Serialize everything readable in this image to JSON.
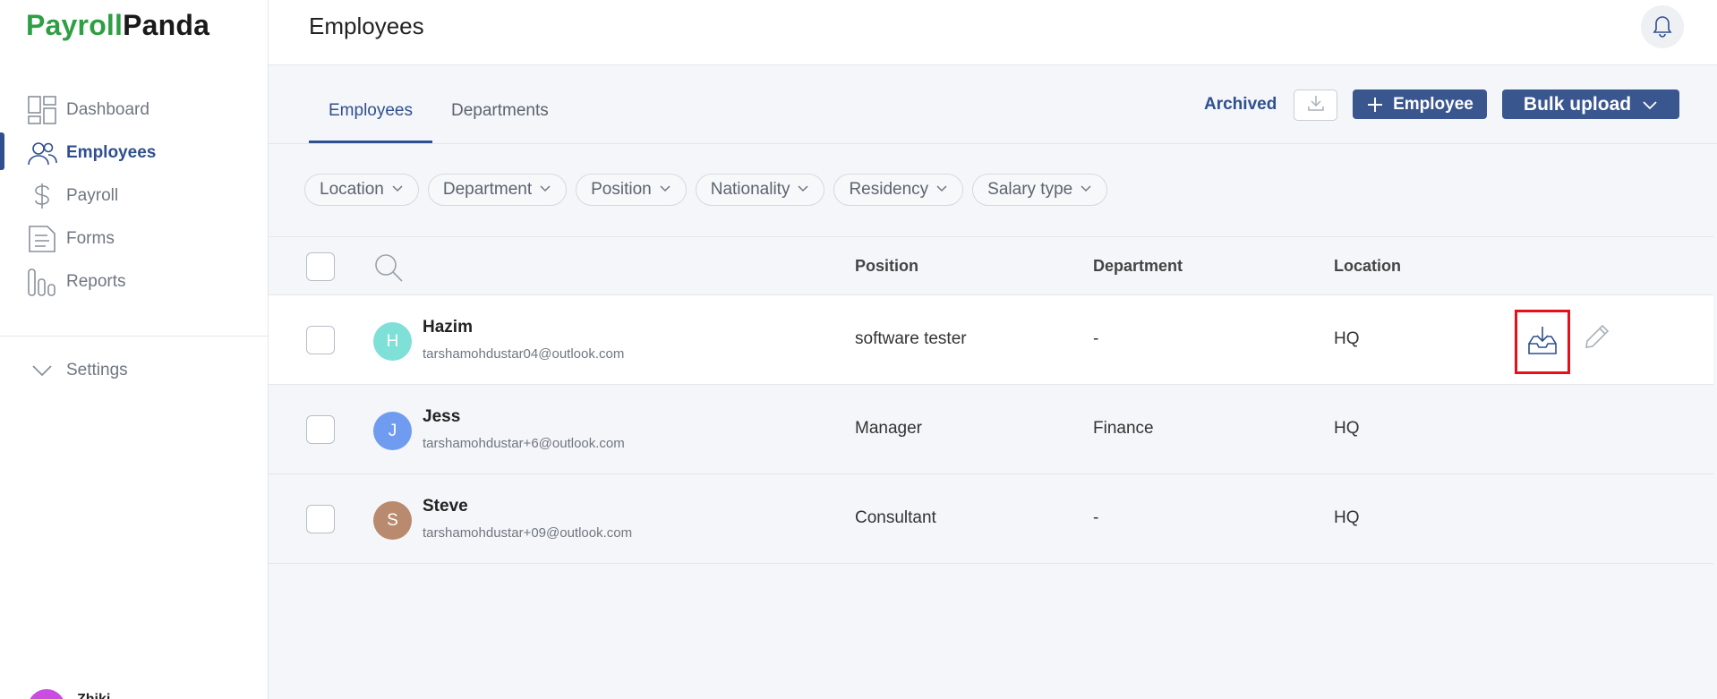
{
  "brand": {
    "part1": "Payroll",
    "part2": "Panda"
  },
  "sidebar": {
    "items": [
      {
        "label": "Dashboard",
        "icon": "dashboard-icon"
      },
      {
        "label": "Employees",
        "icon": "users-icon",
        "active": true
      },
      {
        "label": "Payroll",
        "icon": "dollar-icon"
      },
      {
        "label": "Forms",
        "icon": "document-icon"
      },
      {
        "label": "Reports",
        "icon": "reports-icon"
      }
    ],
    "settings_label": "Settings",
    "user_name": "Zhiki"
  },
  "header": {
    "title": "Employees"
  },
  "tabs": [
    {
      "label": "Employees",
      "active": true
    },
    {
      "label": "Departments",
      "active": false
    }
  ],
  "toolbar": {
    "archived_label": "Archived",
    "add_employee_label": "Employee",
    "bulk_upload_label": "Bulk upload"
  },
  "filters": [
    "Location",
    "Department",
    "Position",
    "Nationality",
    "Residency",
    "Salary type"
  ],
  "table": {
    "columns": {
      "position": "Position",
      "department": "Department",
      "location": "Location"
    },
    "rows": [
      {
        "initial": "H",
        "name": "Hazim",
        "email": "tarshamohdustar04@outlook.com",
        "position": "software tester",
        "department": "-",
        "location": "HQ",
        "avatar_color": "#7fe0d8"
      },
      {
        "initial": "J",
        "name": "Jess",
        "email": "tarshamohdustar+6@outlook.com",
        "position": "Manager",
        "department": "Finance",
        "location": "HQ",
        "avatar_color": "#6f9cf0"
      },
      {
        "initial": "S",
        "name": "Steve",
        "email": "tarshamohdustar+09@outlook.com",
        "position": "Consultant",
        "department": "-",
        "location": "HQ",
        "avatar_color": "#b98a6e"
      }
    ]
  },
  "colors": {
    "brand_green": "#2f9e44",
    "primary": "#3a568f",
    "highlight_red": "#e5101a"
  }
}
